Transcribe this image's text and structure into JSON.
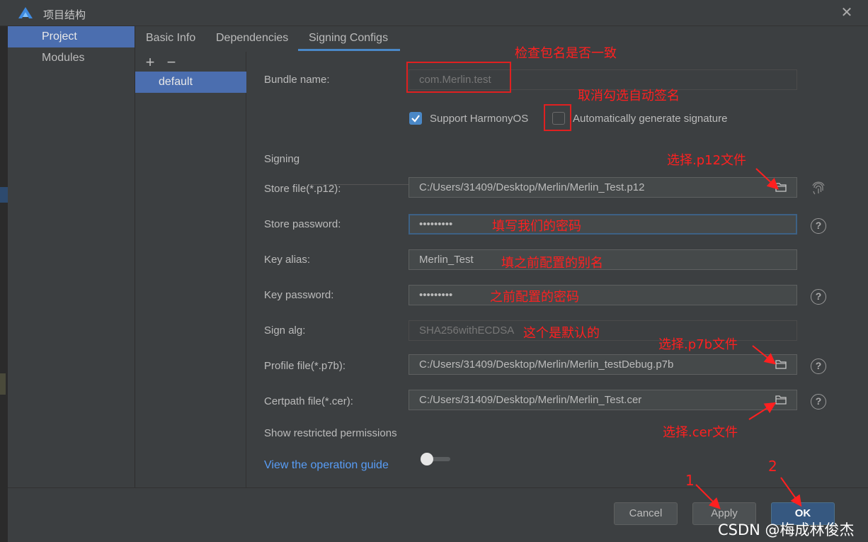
{
  "window": {
    "title": "项目结构",
    "close_glyph": "✕"
  },
  "nav": {
    "items": [
      {
        "label": "Project",
        "active": true
      },
      {
        "label": "Modules",
        "active": false
      }
    ]
  },
  "tabs": [
    {
      "label": "Basic Info"
    },
    {
      "label": "Dependencies"
    },
    {
      "label": "Signing Configs",
      "active": true
    }
  ],
  "config_list": {
    "add_glyph": "+",
    "remove_glyph": "−",
    "items": [
      "default"
    ]
  },
  "form": {
    "bundle_name": {
      "label": "Bundle name:",
      "value": "com.Merlin.test"
    },
    "support_harmonyos": {
      "label": "Support HarmonyOS",
      "checked": true
    },
    "auto_signature": {
      "label": "Automatically generate signature",
      "checked": false
    },
    "signing_section": "Signing",
    "store_file": {
      "label": "Store file(*.p12):",
      "value": "C:/Users/31409/Desktop/Merlin/Merlin_Test.p12"
    },
    "store_password": {
      "label": "Store password:",
      "value": "•••••••••"
    },
    "key_alias": {
      "label": "Key alias:",
      "value": "Merlin_Test"
    },
    "key_password": {
      "label": "Key password:",
      "value": "•••••••••"
    },
    "sign_alg": {
      "label": "Sign alg:",
      "value": "SHA256withECDSA"
    },
    "profile_file": {
      "label": "Profile file(*.p7b):",
      "value": "C:/Users/31409/Desktop/Merlin/Merlin_testDebug.p7b"
    },
    "certpath_file": {
      "label": "Certpath file(*.cer):",
      "value": "C:/Users/31409/Desktop/Merlin/Merlin_Test.cer"
    },
    "show_restricted": {
      "label": "Show restricted permissions",
      "on": false
    },
    "help_glyph": "?",
    "guide_link": "View the operation guide"
  },
  "footer": {
    "cancel": "Cancel",
    "apply": "Apply",
    "ok": "OK"
  },
  "annotations": {
    "check_bundle": "检查包名是否一致",
    "uncheck_auto": "取消勾选自动签名",
    "choose_p12": "选择.p12文件",
    "fill_password": "填写我们的密码",
    "fill_alias": "填之前配置的别名",
    "key_password": "之前配置的密码",
    "default_alg": "这个是默认的",
    "choose_p7b": "选择.p7b文件",
    "choose_cer": "选择.cer文件",
    "step1": "1",
    "step2": "2",
    "color": "#ff2020"
  },
  "watermark": "CSDN @梅成林俊杰",
  "colors": {
    "accent": "#4a88c7",
    "selection": "#4b6eaf",
    "link": "#589df6",
    "primary_button": "#365880"
  }
}
